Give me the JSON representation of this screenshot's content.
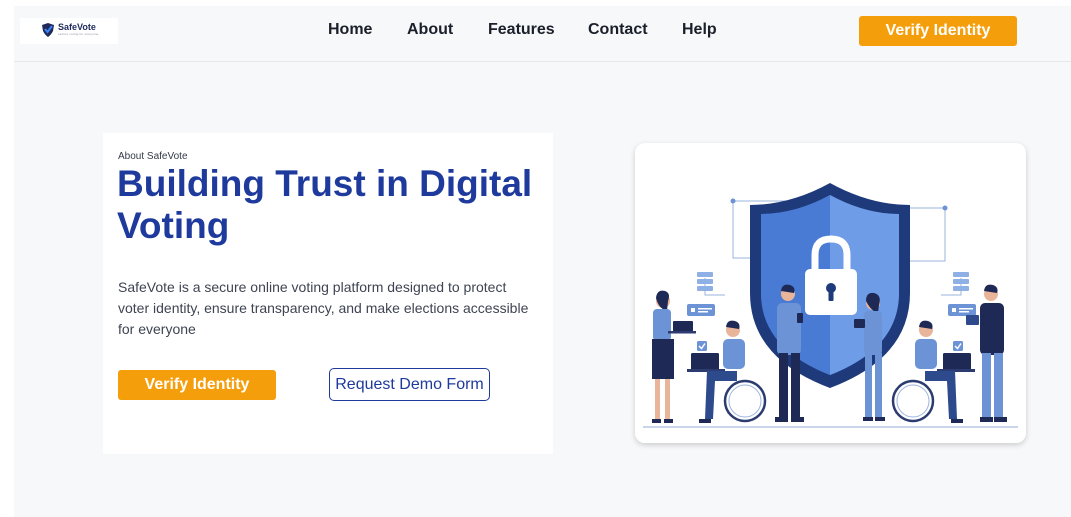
{
  "brand": {
    "name": "SafeVote",
    "tagline": "secure voting for everyone"
  },
  "nav": {
    "links": [
      "Home",
      "About",
      "Features",
      "Contact",
      "Help"
    ],
    "cta": "Verify Identity"
  },
  "hero": {
    "eyebrow": "About SafeVote",
    "title": "Building Trust in Digital Voting",
    "description": "SafeVote is a secure online voting platform designed to protect voter identity, ensure transparency, and make elections accessible for everyone",
    "primary_cta": "Verify Identity",
    "secondary_cta": "Request Demo Form"
  },
  "illustration": {
    "icon": "security-shield-lock-illustration"
  },
  "colors": {
    "accent": "#f59e0b",
    "brand_blue": "#1e3a9c",
    "background": "#f7f8fa"
  }
}
